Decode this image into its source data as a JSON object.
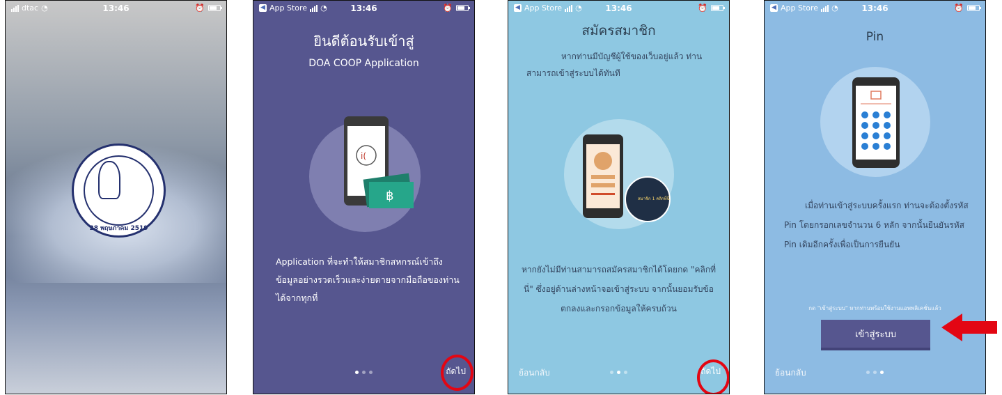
{
  "screens": [
    {
      "status": {
        "carrier": "dtac",
        "time": "13:46"
      },
      "seal": {
        "text": "28 พฤษภาคม 2519"
      }
    },
    {
      "status": {
        "carrier": "App Store",
        "time": "13:46"
      },
      "title": "ยินดีต้อนรับเข้าสู่",
      "subtitle": "DOA COOP Application",
      "description": "Application ที่จะทำให้สมาชิกสหกรณ์เข้าถึงข้อมูลอย่างรวดเร็วและง่ายดายจากมือถือของท่านได้จากทุกที่",
      "next_label": "ถัดไป",
      "page_index": 1
    },
    {
      "status": {
        "carrier": "App Store",
        "time": "13:46"
      },
      "title": "สมัครสมาชิก",
      "intro": "หากท่านมีบัญชีผู้ใช้ของเว็บอยู่แล้ว ท่านสามารถเข้าสู่ระบบได้ทันที",
      "card_caption": "สมาชิก 1 คลิกที่นี่",
      "description": "หากยังไม่มีท่านสามารถสมัครสมาชิกได้โดยกด \"คลิกที่นี่\" ซึ่งอยู่ด้านล่างหน้าจอเข้าสู่ระบบ จากนั้นยอมรับข้อตกลงและกรอกข้อมูลให้ครบถ้วน",
      "back_label": "ย้อนกลับ",
      "next_label": "ถัดไป",
      "page_index": 2
    },
    {
      "status": {
        "carrier": "App Store",
        "time": "13:46"
      },
      "title": "Pin",
      "description": "เมื่อท่านเข้าสู่ระบบครั้งแรก ท่านจะต้องตั้งรหัส Pin โดยกรอกเลขจำนวน 6 หลัก จากนั้นยืนยันรหัส Pin เดิมอีกครั้งเพื่อเป็นการยืนยัน",
      "note": "กด \"เข้าสู่ระบบ\" หากท่านพร้อมใช้งานแอพพลิเคชั่นแล้ว",
      "login_label": "เข้าสู่ระบบ",
      "back_label": "ย้อนกลับ",
      "page_index": 3
    }
  ],
  "colors": {
    "screen2_bg": "#56568f",
    "screen3_bg": "#8ec8e2",
    "screen4_bg": "#8dbbe3",
    "highlight": "#e30613"
  }
}
